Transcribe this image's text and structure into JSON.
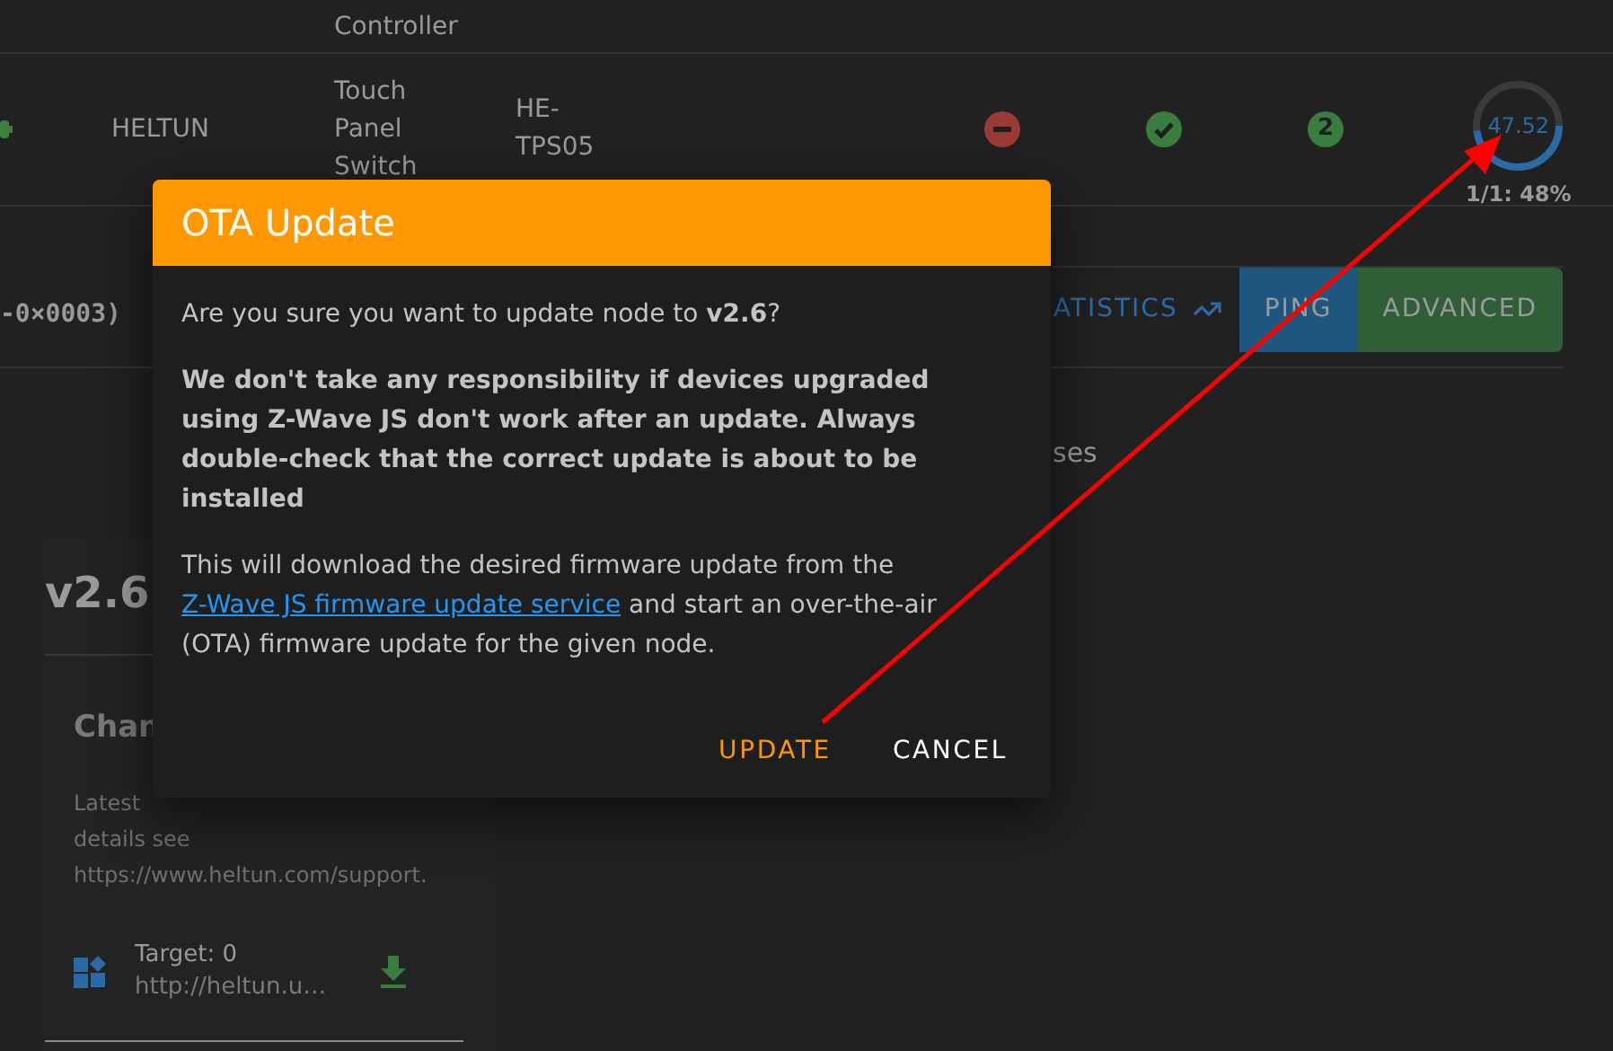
{
  "device_table": {
    "rows": [
      {
        "description": "Controller"
      },
      {
        "manufacturer": "HELTUN",
        "description": "Touch Panel Switch",
        "product_code": "HE-TPS05",
        "statuses": [
          {
            "kind": "error"
          },
          {
            "kind": "ok"
          },
          {
            "kind": "security",
            "text": "2"
          }
        ],
        "update_progress": {
          "value": "47.52",
          "level": 0.48,
          "label": "1/1: 48%"
        }
      }
    ]
  },
  "node_header": {
    "id_text": "-0×0003)",
    "actions": [
      {
        "label": "ATISTICS",
        "kind": "text"
      },
      {
        "label": "PING",
        "kind": "filled",
        "color": "#1f5680"
      },
      {
        "label": "ADVANCED",
        "kind": "filled",
        "color": "#2f5e37"
      }
    ]
  },
  "partial_text": "ses",
  "firmware_card": {
    "version": "v2.6",
    "heading": "Chan",
    "text_lines": [
      "Latest",
      "details see",
      "https://www.heltun.com/support."
    ],
    "files": [
      {
        "target": "Target: 0",
        "url": "http://heltun.u…"
      }
    ]
  },
  "dialog": {
    "title": "OTA Update",
    "question": "Are you sure you want to update node to **v2.6**?",
    "warning": "We don't take any responsibility if devices upgraded using Z-Wave JS don't work after an update. Always double-check that the correct update is about to be installed",
    "info": {
      "before": "This will download the desired firmware update from the",
      "link": "Z-Wave JS firmware update service",
      "after": "and start an over-the-air (OTA) firmware update for the given node."
    },
    "buttons": [
      {
        "label": "UPDATE",
        "kind": "primary"
      },
      {
        "label": "CANCEL",
        "kind": "secondary"
      }
    ]
  }
}
